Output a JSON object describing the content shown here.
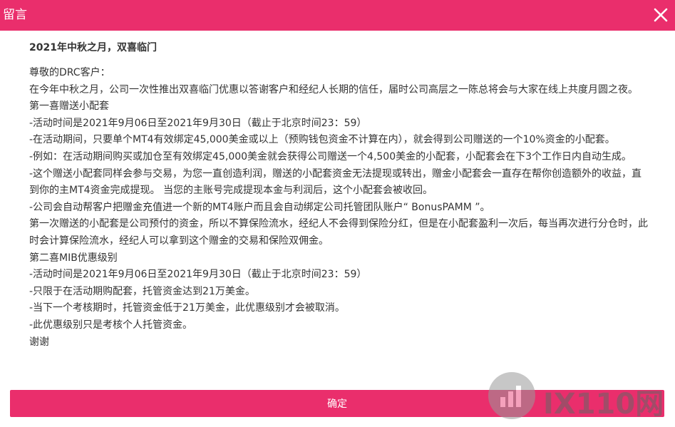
{
  "dialog": {
    "title": "留言",
    "close_icon": "close-icon",
    "confirm_label": "确定",
    "accent_color": "#ea2e6c"
  },
  "message": {
    "title": "2021年中秋之月，双喜临门",
    "lines": [
      "尊敬的DRC客户：",
      "在今年中秋之月，公司一次性推出双喜临门优惠以答谢客户和经纪人长期的信任，届时公司高层之一陈总将会与大家在线上共度月圆之夜。",
      "第一喜赠送小配套",
      "-活动时间是2021年9月06日至2021年9月30日（截止于北京时间23：59）",
      "-在活动期间，只要单个MT4有效绑定45,000美金或以上（预购钱包资金不计算在内），就会得到公司赠送的一个10%资金的小配套。",
      "-例如：在活动期间购买或加仓至有效绑定45,000美金就会获得公司赠送一个4,500美金的小配套，小配套会在下3个工作日内自动生成。",
      "-这个赠送小配套同样会参与交易，为您一直创造利润，赠送的小配套资金无法提现或转出，赠金小配套会一直存在帮你创造额外的收益，直到你的主MT4资金完成提现。 当您的主账号完成提现本金与利润后，这个小配套会被收回。",
      "-公司会自动帮客户把赠金充值进一个新的MT4账户而且会自动绑定公司托管团队账户“ BonusPAMM ”。",
      "第一次赠送的小配套是公司预付的资金，所以不算保险流水，经纪人不会得到保险分红，但是在小配套盈利一次后，每当再次进行分仓时，此时会计算保险流水，经纪人可以拿到这个赠金的交易和保险双佣金。",
      "第二喜MIB优惠级别",
      "-活动时间是2021年9月06日至2021年9月30日（截止于北京时间23：59）",
      "-只限于在活动期购配套，托管资金达到21万美金。",
      "-当下一个考核期时，托管资金低于21万美金，此优惠级别才会被取消。",
      "-此优惠级别只是考核个人托管资金。",
      "谢谢"
    ]
  },
  "watermark": {
    "text": "IX110网",
    "icon": "chart-logo-icon"
  }
}
